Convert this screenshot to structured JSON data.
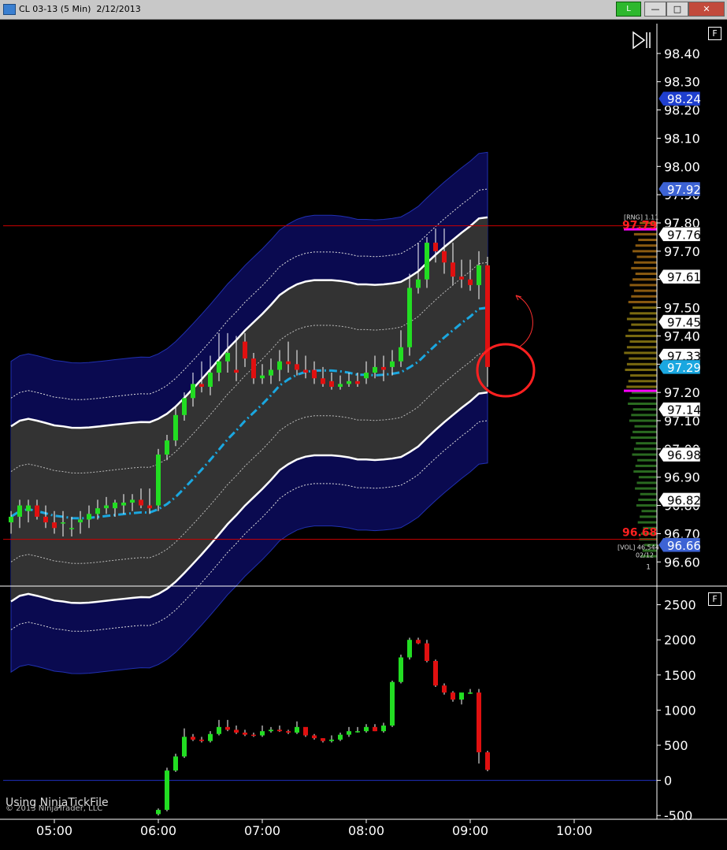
{
  "window": {
    "title": "CL 03-13 (5 Min)  2/12/2013",
    "link_button": "L",
    "minimize_label": "—",
    "maximize_label": "□",
    "close_label": "✕"
  },
  "panel_buttons": {
    "top": "F",
    "bottom": "F"
  },
  "play_icon": "play-pause-icon",
  "time_axis": {
    "labels": [
      "05:00",
      "06:00",
      "07:00",
      "08:00",
      "09:00",
      "10:00"
    ]
  },
  "price_axis": {
    "labels": [
      "98.40",
      "98.30",
      "98.20",
      "98.10",
      "98.00",
      "97.90",
      "97.80",
      "97.70",
      "97.60",
      "97.50",
      "97.40",
      "97.30",
      "97.20",
      "97.10",
      "97.00",
      "96.90",
      "96.80",
      "96.70",
      "96.60"
    ]
  },
  "volume_axis": {
    "labels": [
      "2500",
      "2000",
      "1500",
      "1000",
      "500",
      "0",
      "-500"
    ]
  },
  "price_tags": [
    {
      "value": "98.24",
      "color": "#1f3fcf",
      "text_color": "#ffffff"
    },
    {
      "value": "97.92",
      "color": "#3d63d4",
      "text_color": "#ffffff"
    },
    {
      "value": "97.76",
      "color": "#ffffff",
      "text_color": "#000000"
    },
    {
      "value": "97.61",
      "color": "#ffffff",
      "text_color": "#000000"
    },
    {
      "value": "97.45",
      "color": "#ffffff",
      "text_color": "#000000"
    },
    {
      "value": "97.33",
      "color": "#ffffff",
      "text_color": "#000000"
    },
    {
      "value": "97.29",
      "color": "#1aa7e0",
      "text_color": "#ffffff"
    },
    {
      "value": "97.14",
      "color": "#ffffff",
      "text_color": "#000000"
    },
    {
      "value": "96.98",
      "color": "#ffffff",
      "text_color": "#000000"
    },
    {
      "value": "96.82",
      "color": "#ffffff",
      "text_color": "#000000"
    },
    {
      "value": "96.66",
      "color": "#3d63d4",
      "text_color": "#ffffff"
    }
  ],
  "range_labels": {
    "high": "97.79",
    "low": "96.68",
    "rng": "[RNG] 1.11",
    "vol": "[VOL] 46,544",
    "date": "02/12",
    "count": "1"
  },
  "footer": {
    "note": "Using NinjaTickFile",
    "copyright": "© 2013 NinjaTrader, LLC"
  },
  "colors": {
    "up": "#22dd22",
    "down": "#e01010",
    "band_outer": "#0a0a55",
    "band_inner": "#333333",
    "midline": "#1aa7e0",
    "rng_line": "#cc0000"
  },
  "chart_data": {
    "type": "candlestick",
    "times": [
      "04:35",
      "04:40",
      "04:45",
      "04:50",
      "04:55",
      "05:00",
      "05:05",
      "05:10",
      "05:15",
      "05:20",
      "05:25",
      "05:30",
      "05:35",
      "05:40",
      "05:45",
      "05:50",
      "05:55",
      "06:00",
      "06:05",
      "06:10",
      "06:15",
      "06:20",
      "06:25",
      "06:30",
      "06:35",
      "06:40",
      "06:45",
      "06:50",
      "06:55",
      "07:00",
      "07:05",
      "07:10",
      "07:15",
      "07:20",
      "07:25",
      "07:30",
      "07:35",
      "07:40",
      "07:45",
      "07:50",
      "07:55",
      "08:00",
      "08:05",
      "08:10",
      "08:15",
      "08:20",
      "08:25",
      "08:30",
      "08:35",
      "08:40",
      "08:45",
      "08:50",
      "08:55",
      "09:00",
      "09:05",
      "09:10"
    ],
    "open": [
      96.74,
      96.76,
      96.78,
      96.8,
      96.76,
      96.74,
      96.74,
      96.72,
      96.74,
      96.75,
      96.77,
      96.79,
      96.79,
      96.8,
      96.81,
      96.82,
      96.8,
      96.8,
      96.98,
      97.03,
      97.12,
      97.18,
      97.23,
      97.22,
      97.27,
      97.31,
      97.28,
      97.38,
      97.32,
      97.25,
      97.26,
      97.28,
      97.31,
      97.3,
      97.28,
      97.28,
      97.25,
      97.24,
      97.22,
      97.23,
      97.24,
      97.25,
      97.27,
      97.29,
      97.29,
      97.31,
      97.36,
      97.57,
      97.6,
      97.73,
      97.7,
      97.66,
      97.61,
      97.6,
      97.58,
      97.65
    ],
    "high": [
      96.78,
      96.82,
      96.82,
      96.82,
      96.8,
      96.78,
      96.78,
      96.76,
      96.78,
      96.8,
      96.82,
      96.83,
      96.82,
      96.84,
      96.84,
      96.86,
      96.86,
      97.0,
      97.05,
      97.15,
      97.2,
      97.27,
      97.31,
      97.33,
      97.41,
      97.41,
      97.4,
      97.41,
      97.34,
      97.3,
      97.32,
      97.35,
      97.38,
      97.35,
      97.33,
      97.31,
      97.29,
      97.27,
      97.26,
      97.27,
      97.27,
      97.31,
      97.33,
      97.33,
      97.35,
      97.42,
      97.62,
      97.73,
      97.75,
      97.78,
      97.78,
      97.73,
      97.67,
      97.67,
      97.7,
      97.68
    ],
    "low": [
      96.7,
      96.72,
      96.74,
      96.75,
      96.72,
      96.7,
      96.69,
      96.69,
      96.7,
      96.72,
      96.75,
      96.77,
      96.76,
      96.77,
      96.78,
      96.79,
      96.77,
      96.78,
      96.96,
      97.01,
      97.1,
      97.15,
      97.2,
      97.19,
      97.24,
      97.27,
      97.24,
      97.29,
      97.23,
      97.23,
      97.23,
      97.24,
      97.27,
      97.26,
      97.25,
      97.23,
      97.22,
      97.21,
      97.21,
      97.22,
      97.22,
      97.23,
      97.25,
      97.24,
      97.26,
      97.29,
      97.33,
      97.55,
      97.57,
      97.66,
      97.62,
      97.58,
      97.57,
      97.56,
      97.53,
      97.22
    ],
    "close": [
      96.76,
      96.8,
      96.8,
      96.76,
      96.74,
      96.72,
      96.74,
      96.72,
      96.75,
      96.77,
      96.79,
      96.8,
      96.81,
      96.81,
      96.82,
      96.8,
      96.79,
      96.98,
      97.03,
      97.12,
      97.18,
      97.23,
      97.22,
      97.27,
      97.31,
      97.34,
      97.27,
      97.32,
      97.25,
      97.26,
      97.28,
      97.31,
      97.3,
      97.28,
      97.27,
      97.25,
      97.23,
      97.22,
      97.23,
      97.24,
      97.23,
      97.27,
      97.29,
      97.28,
      97.31,
      97.36,
      97.57,
      97.6,
      97.73,
      97.7,
      97.66,
      97.61,
      97.6,
      97.58,
      97.65,
      97.29
    ],
    "volume_indicator": {
      "type": "candlestick",
      "note": "cumulative volume delta bars",
      "open": [
        null,
        null,
        null,
        null,
        null,
        null,
        null,
        null,
        null,
        null,
        null,
        null,
        null,
        null,
        null,
        null,
        null,
        -480,
        -420,
        140,
        340,
        620,
        580,
        560,
        660,
        760,
        720,
        680,
        650,
        640,
        700,
        720,
        700,
        680,
        760,
        640,
        600,
        560,
        580,
        650,
        700,
        700,
        760,
        700,
        780,
        1400,
        1750,
        2000,
        1950,
        1700,
        1350,
        1250,
        1150,
        1250,
        1250,
        400
      ],
      "close": [
        null,
        null,
        null,
        null,
        null,
        null,
        null,
        null,
        null,
        null,
        null,
        null,
        null,
        null,
        null,
        null,
        null,
        -420,
        140,
        340,
        620,
        580,
        560,
        660,
        760,
        720,
        680,
        650,
        640,
        700,
        720,
        700,
        680,
        760,
        640,
        600,
        560,
        580,
        650,
        700,
        700,
        760,
        700,
        780,
        1400,
        1750,
        2000,
        1950,
        1700,
        1350,
        1250,
        1150,
        1250,
        1250,
        400,
        150
      ],
      "high": [
        null,
        null,
        null,
        null,
        null,
        null,
        null,
        null,
        null,
        null,
        null,
        null,
        null,
        null,
        null,
        null,
        null,
        -400,
        180,
        380,
        740,
        660,
        620,
        700,
        860,
        860,
        780,
        720,
        680,
        780,
        760,
        780,
        720,
        840,
        700,
        660,
        600,
        640,
        680,
        760,
        760,
        800,
        800,
        820,
        1420,
        1790,
        2030,
        2030,
        2000,
        1720,
        1380,
        1270,
        1200,
        1300,
        1300,
        420
      ],
      "low": [
        null,
        null,
        null,
        null,
        null,
        null,
        null,
        null,
        null,
        null,
        null,
        null,
        null,
        null,
        null,
        null,
        null,
        -500,
        -440,
        120,
        320,
        560,
        540,
        540,
        640,
        700,
        660,
        630,
        620,
        620,
        680,
        690,
        660,
        660,
        620,
        580,
        540,
        540,
        560,
        620,
        680,
        680,
        700,
        680,
        760,
        1380,
        1720,
        1940,
        1680,
        1330,
        1220,
        1120,
        1080,
        1230,
        240,
        130
      ]
    },
    "ylim": [
      96.52,
      98.5
    ],
    "volume_ylim": [
      -520,
      2720
    ]
  }
}
